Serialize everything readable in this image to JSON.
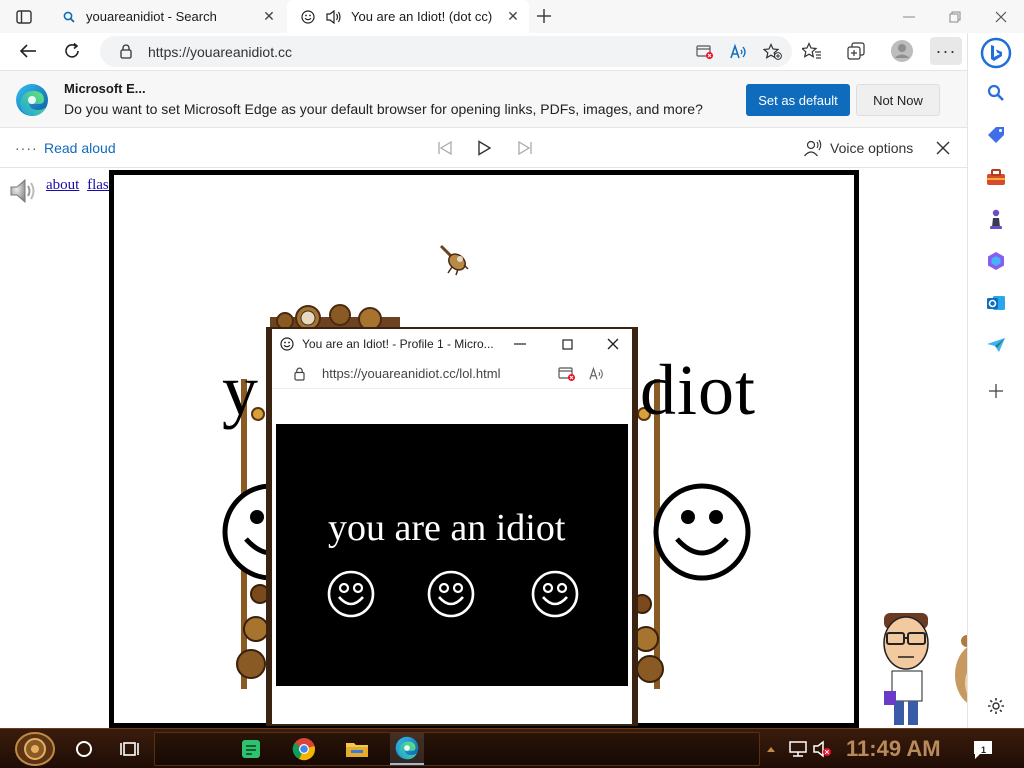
{
  "browser": {
    "tabs": [
      {
        "title": "youareanidiot - Search",
        "favicon": "search-icon",
        "active": false
      },
      {
        "title": "You are an Idiot! (dot cc)",
        "favicon": "smiley-icon",
        "active": true
      }
    ],
    "url": "https://youareanidiot.cc",
    "more_label": "···"
  },
  "infobar": {
    "title": "Microsoft E...",
    "message": "Do you want to set Microsoft Edge as your default browser for opening links, PDFs, images, and more?",
    "primary_button": "Set as default",
    "secondary_button": "Not Now"
  },
  "read_aloud": {
    "label": "Read aloud",
    "voice_options": "Voice options"
  },
  "page": {
    "links": [
      "about",
      "flash"
    ],
    "title_text": "you are an idiot",
    "title_visible_left": "y",
    "title_visible_right": "diot"
  },
  "popup": {
    "title": "You are an Idiot! - Profile 1 - Micro...",
    "url": "https://youareanidiot.cc/lol.html",
    "text": "you are an idiot"
  },
  "taskbar": {
    "clock": "11:49 AM",
    "notification_count": "1"
  },
  "colors": {
    "edge_blue": "#0f6cbd",
    "taskbar_brown": "#2a1408",
    "clock_color": "#b98a5a"
  }
}
